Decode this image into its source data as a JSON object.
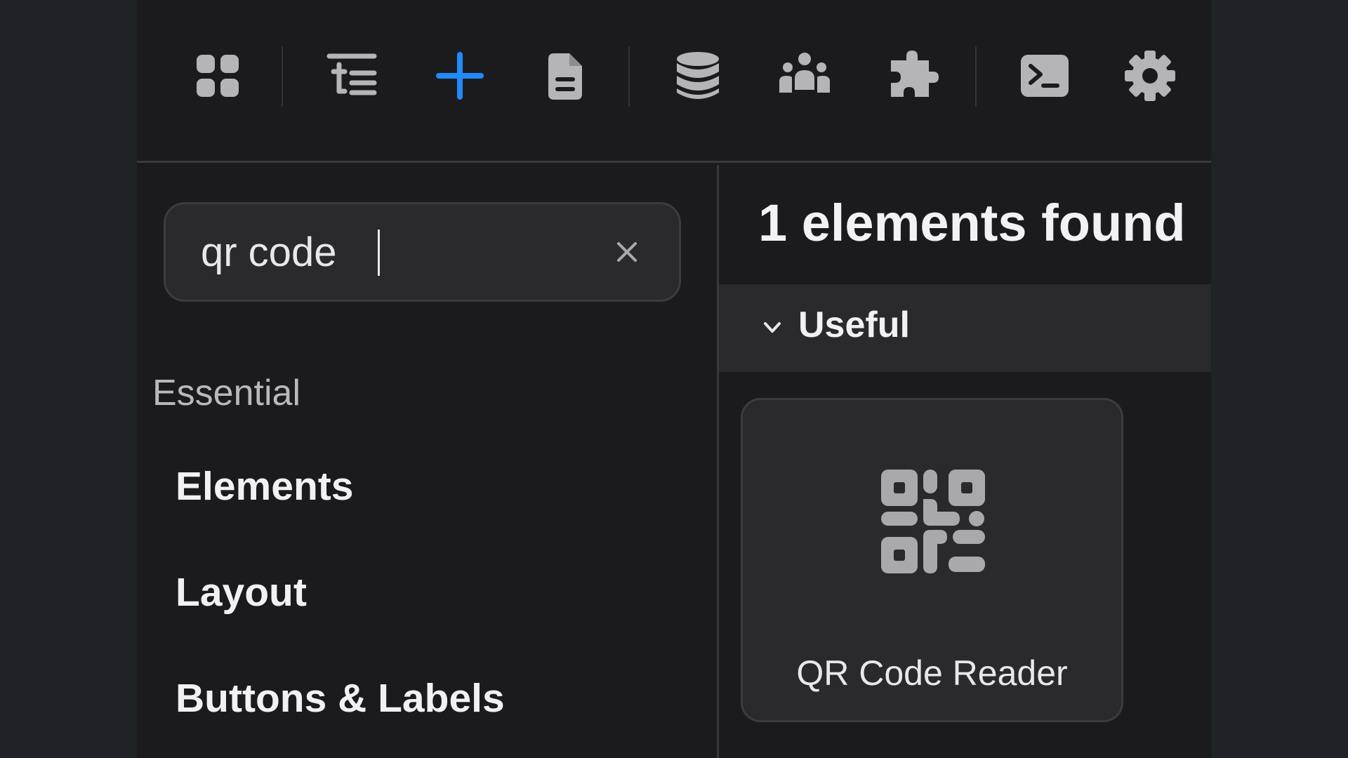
{
  "colors": {
    "accent": "#1e8bff",
    "icon": "#b5b5b8",
    "background": "#1b1b1d",
    "panel": "#2a2a2d"
  },
  "toolbar": {
    "icons": [
      "apps-grid-icon",
      "outline-tree-icon",
      "plus-icon",
      "document-icon",
      "database-icon",
      "users-icon",
      "puzzle-icon",
      "terminal-icon",
      "gear-icon"
    ],
    "active": "plus-icon"
  },
  "search": {
    "value": "qr code",
    "placeholder": ""
  },
  "sidebar": {
    "section": "Essential",
    "items": [
      {
        "label": "Elements"
      },
      {
        "label": "Layout"
      },
      {
        "label": "Buttons & Labels"
      }
    ]
  },
  "results": {
    "count_text": "1 elements found",
    "group": {
      "label": "Useful",
      "icon": "chevron-down-icon"
    },
    "cards": [
      {
        "label": "QR Code Reader",
        "icon": "qr-code-icon"
      }
    ]
  }
}
